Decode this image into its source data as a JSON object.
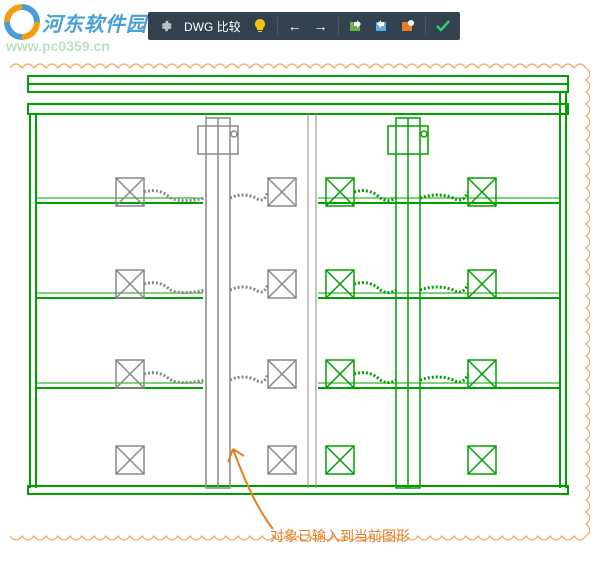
{
  "watermark": {
    "site_name": "河东软件园",
    "url": "www.pc0359.cn"
  },
  "toolbar": {
    "gear_title": "设置",
    "compare_label": "DWG 比较",
    "bulb_title": "提示",
    "prev_title": "上一个",
    "next_title": "下一个",
    "import_title": "导入",
    "export1_title": "输出",
    "export2_title": "输出快照",
    "confirm_title": "确认"
  },
  "annotation": {
    "text": "对象已输入到当前图形"
  },
  "drawing": {
    "colors": {
      "existing": "#00a000",
      "new": "#888888",
      "cloud": "#f4a460"
    }
  }
}
